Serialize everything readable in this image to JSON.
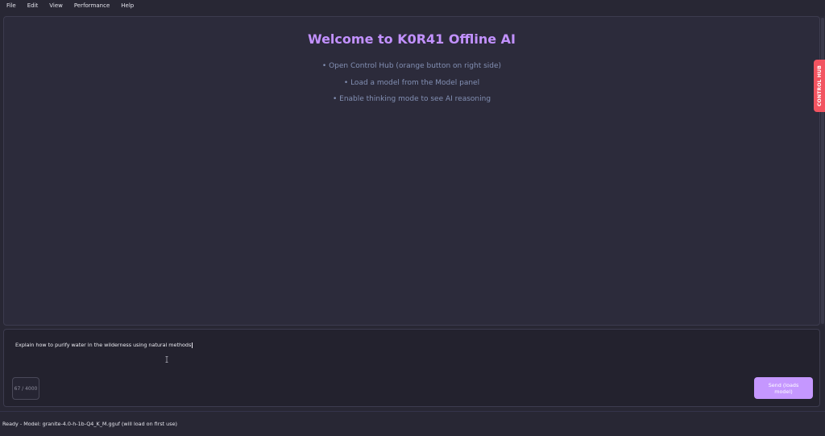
{
  "menu": [
    "File",
    "Edit",
    "View",
    "Performance",
    "Help"
  ],
  "welcome": {
    "title": "Welcome to K0R41 Offline AI",
    "tips": [
      "• Open Control Hub (orange button on right side)",
      "• Load a model from the Model panel",
      "• Enable thinking mode to see AI reasoning"
    ]
  },
  "control_hub": {
    "label": "CONTROL HUB"
  },
  "input": {
    "value": "Explain how to purify water in the wilderness using natural methods",
    "char_count": "67 / 4000"
  },
  "send_button": {
    "label": "Send (loads model)"
  },
  "status": {
    "text": "Ready - Model: granite-4.0-h-1b-Q4_K_M.gguf (will load on first use)"
  },
  "colors": {
    "background": "#282734",
    "accent_purple": "#c291ff",
    "control_hub_red": "#f25461",
    "tip_text": "#8390b4"
  }
}
